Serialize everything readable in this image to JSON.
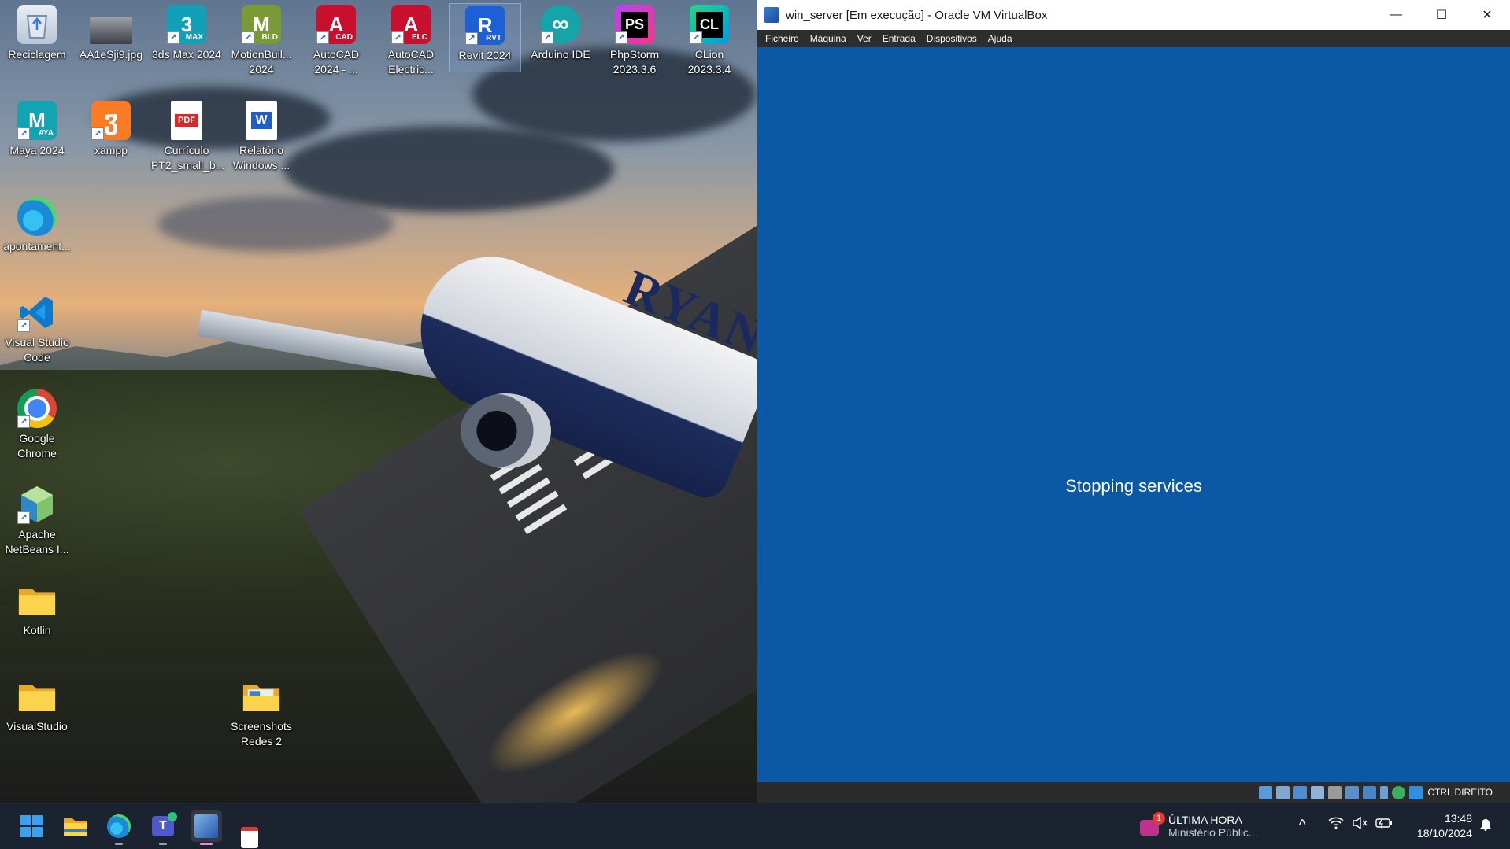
{
  "desktop": {
    "icons": [
      {
        "label": "Reciclagem",
        "icon": "recycle-bin-icon"
      },
      {
        "label": "AA1eSji9.jpg",
        "icon": "image-file-icon"
      },
      {
        "label": "3ds Max 2024",
        "icon": "3dsmax-icon",
        "glyph": "3",
        "tag": "MAX"
      },
      {
        "label": "MotionBuil... 2024",
        "icon": "motionbuilder-icon",
        "glyph": "M",
        "tag": "BLD"
      },
      {
        "label": "AutoCAD 2024 - ...",
        "icon": "autocad-icon",
        "glyph": "A",
        "tag": "CAD"
      },
      {
        "label": "AutoCAD Electric...",
        "icon": "autocad-electrical-icon",
        "glyph": "A",
        "tag": "ELC"
      },
      {
        "label": "Revit 2024",
        "icon": "revit-icon",
        "glyph": "R",
        "tag": "RVT"
      },
      {
        "label": "Arduino IDE",
        "icon": "arduino-icon",
        "glyph": "∞"
      },
      {
        "label": "PhpStorm 2023.3.6",
        "icon": "phpstorm-icon",
        "glyph": "PS"
      },
      {
        "label": "CLion 2023.3.4",
        "icon": "clion-icon",
        "glyph": "CL"
      },
      {
        "label": "Maya 2024",
        "icon": "maya-icon",
        "glyph": "M",
        "tag": "AYA"
      },
      {
        "label": "xampp",
        "icon": "xampp-icon",
        "glyph": "ჳ"
      },
      {
        "label": "Currículo PT2_small_b...",
        "icon": "pdf-file-icon",
        "glyph": "PDF"
      },
      {
        "label": "Relatório Windows ...",
        "icon": "word-file-icon",
        "glyph": "W"
      },
      {
        "label": "apontament...",
        "icon": "edge-icon"
      },
      {
        "label": "Visual Studio Code",
        "icon": "vscode-icon"
      },
      {
        "label": "Google Chrome",
        "icon": "chrome-icon"
      },
      {
        "label": "Apache NetBeans I...",
        "icon": "netbeans-icon"
      },
      {
        "label": "Kotlin",
        "icon": "folder-icon"
      },
      {
        "label": "VisualStudio",
        "icon": "folder-icon"
      },
      {
        "label": "Screenshots Redes 2",
        "icon": "folder-icon"
      }
    ],
    "wallpaper_text": "RYAN"
  },
  "vbox": {
    "title": "win_server [Em execução] - Oracle VM VirtualBox",
    "menu": [
      "Ficheiro",
      "Máquina",
      "Ver",
      "Entrada",
      "Dispositivos",
      "Ajuda"
    ],
    "screen_message": "Stopping services",
    "host_key": "CTRL DIREITO",
    "controls": {
      "minimize": "—",
      "maximize": "☐",
      "close": "✕"
    },
    "screen_color": "#0b59a4"
  },
  "taskbar": {
    "news_badge": "1",
    "news_title": "ÚLTIMA HORA",
    "news_subtitle": "Ministério Públic...",
    "time": "13:48",
    "date": "18/10/2024",
    "tray": {
      "chevron": "^",
      "wifi": "wifi-icon",
      "volume": "volume-muted-icon",
      "battery": "battery-icon",
      "bell": "notification-bell-icon"
    }
  }
}
